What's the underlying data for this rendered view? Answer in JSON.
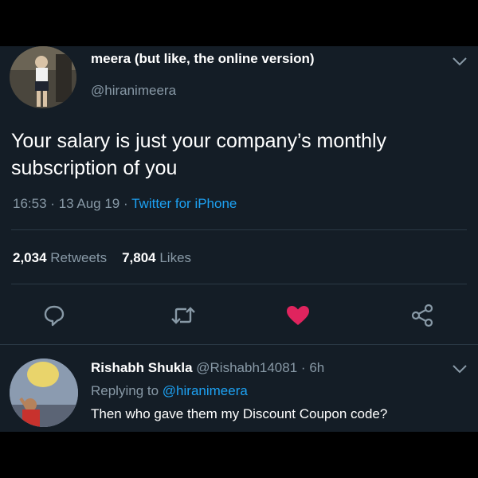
{
  "tweet": {
    "display_name": "meera (but like, the online version)",
    "handle": "@hiranimeera",
    "text": "Your salary is just your company’s monthly subscription of you",
    "time": "16:53",
    "date": "13 Aug 19",
    "source": "Twitter for iPhone",
    "separator": "·",
    "retweets_count": "2,034",
    "retweets_label": "Retweets",
    "likes_count": "7,804",
    "likes_label": "Likes"
  },
  "actions": {
    "reply_icon": "comment-icon",
    "retweet_icon": "retweet-icon",
    "like_icon": "heart-icon",
    "share_icon": "share-icon"
  },
  "reply": {
    "display_name": "Rishabh Shukla",
    "handle": "@Rishabh14081",
    "age": "6h",
    "replying_label": "Replying to",
    "replying_handle": "@hiranimeera",
    "text": "Then who gave them my Discount Coupon code?"
  },
  "colors": {
    "background": "#141d26",
    "secondary_text": "#8899a6",
    "link": "#1da1f2",
    "like": "#e0245e"
  }
}
